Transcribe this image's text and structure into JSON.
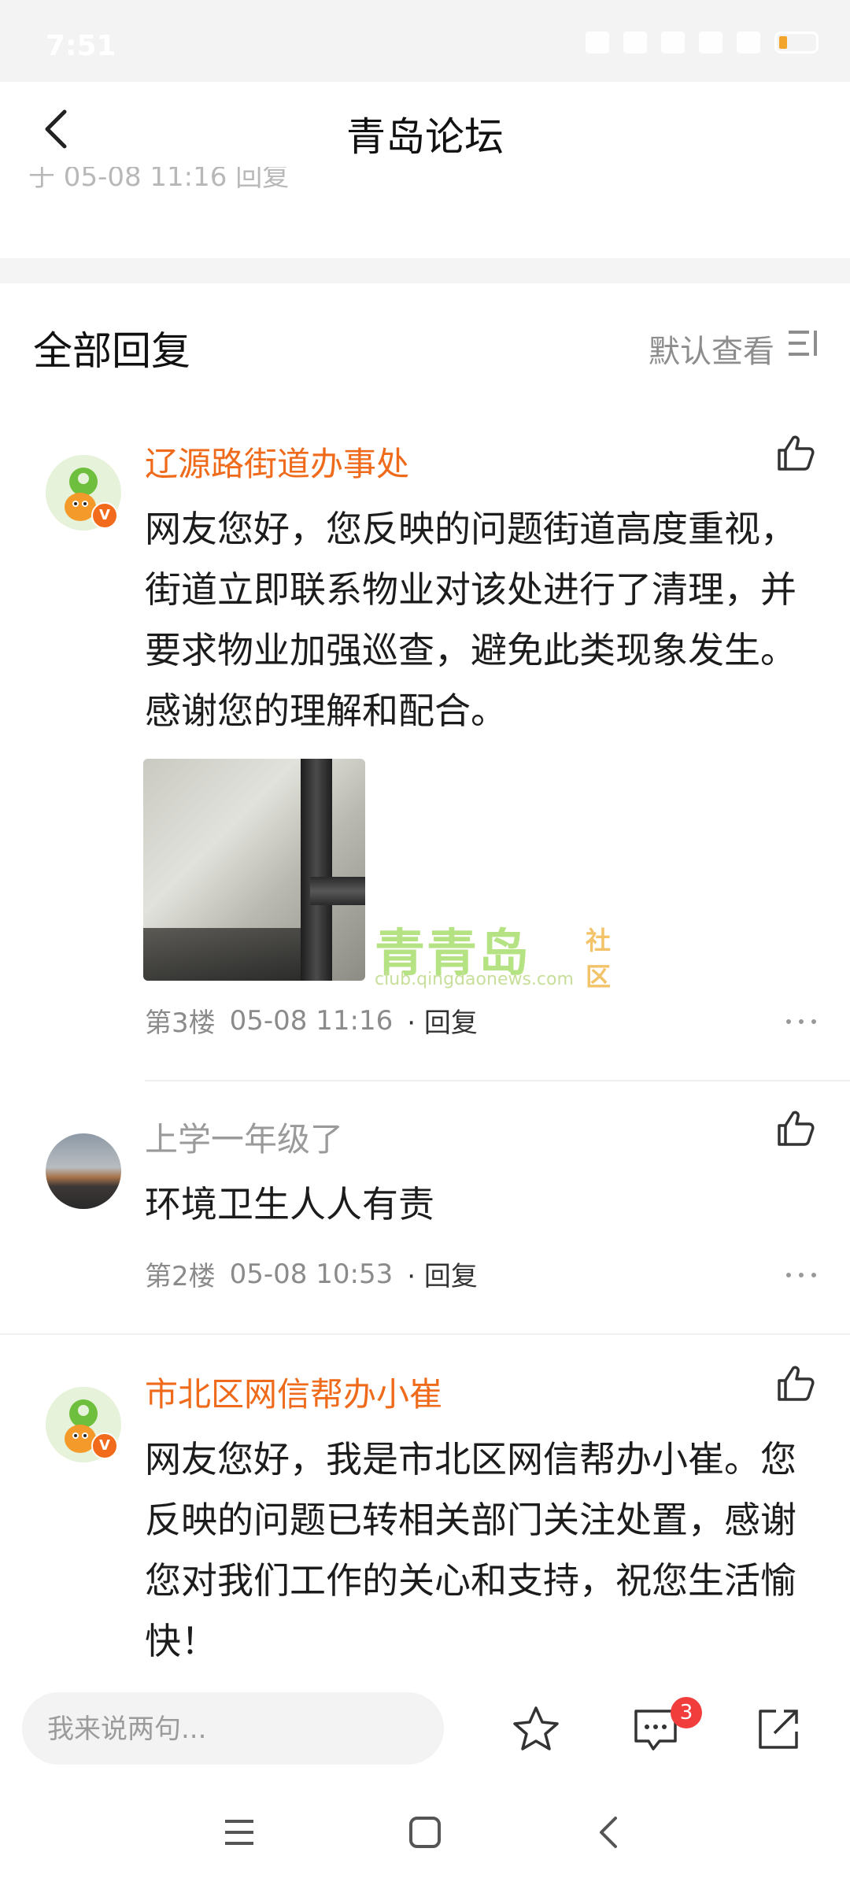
{
  "status_bar": {
    "time": "7:51",
    "battery_level": "27"
  },
  "nav": {
    "title": "青岛论坛"
  },
  "previous_meta": "于 05-08 11:16 回复",
  "section": {
    "title": "全部回复",
    "sort_label": "默认查看"
  },
  "comments": [
    {
      "username": "辽源路街道办事处",
      "badge": "V",
      "content": "网友您好，您反映的问题街道高度重视，街道立即联系物业对该处进行了清理，并要求物业加强巡查，避免此类现象发生。感谢您的理解和配合。",
      "floor": "第3楼",
      "time": "05-08 11:16",
      "reply_label": "· 回复"
    },
    {
      "username": "上学一年级了",
      "content": "环境卫生人人有责",
      "floor": "第2楼",
      "time": "05-08 10:53",
      "reply_label": "· 回复"
    },
    {
      "username": "市北区网信帮办小崔",
      "badge": "V",
      "content": "网友您好，我是市北区网信帮办小崔。您反映的问题已转相关部门关注处置，感谢您对我们工作的关心和支持，祝您生活愉快！"
    }
  ],
  "watermark": {
    "main": "青青岛",
    "sub": "社区",
    "url": "club.qingdaonews.com"
  },
  "bottom_bar": {
    "placeholder": "我来说两句...",
    "comment_count": "3"
  },
  "colors": {
    "accent": "#ef6a1a",
    "badge": "#f23d3d"
  }
}
